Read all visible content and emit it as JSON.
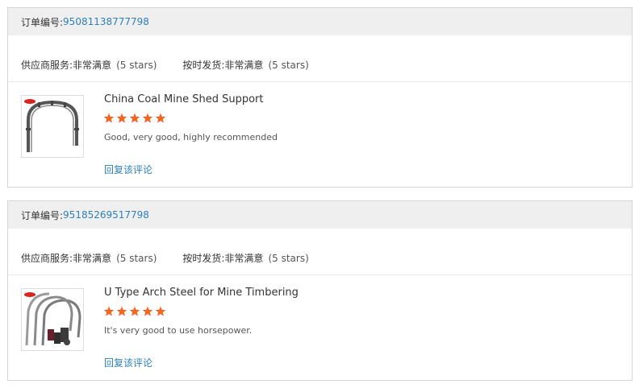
{
  "labels": {
    "order_number": "订单编号: ",
    "supplier_service": "供应商服务: ",
    "on_time_delivery": "按时发货: ",
    "reply": "回复该评论"
  },
  "orders": [
    {
      "order_number": "95081138777798",
      "supplier_service_value": "非常满意",
      "supplier_service_stars": "(5 stars)",
      "on_time_delivery_value": "非常满意",
      "on_time_delivery_stars": "(5 stars)",
      "product_title": "China Coal Mine Shed Support",
      "rating": 5,
      "review": "Good, very good, highly recommended"
    },
    {
      "order_number": "95185269517798",
      "supplier_service_value": "非常满意",
      "supplier_service_stars": "(5 stars)",
      "on_time_delivery_value": "非常满意",
      "on_time_delivery_stars": "(5 stars)",
      "product_title": "U Type Arch Steel for Mine Timbering",
      "rating": 5,
      "review": "It's very good to use horsepower."
    }
  ],
  "colors": {
    "link": "#2d7fc1",
    "star": "#f26522",
    "header_bg": "#efefef",
    "border": "#d6d6d6"
  }
}
